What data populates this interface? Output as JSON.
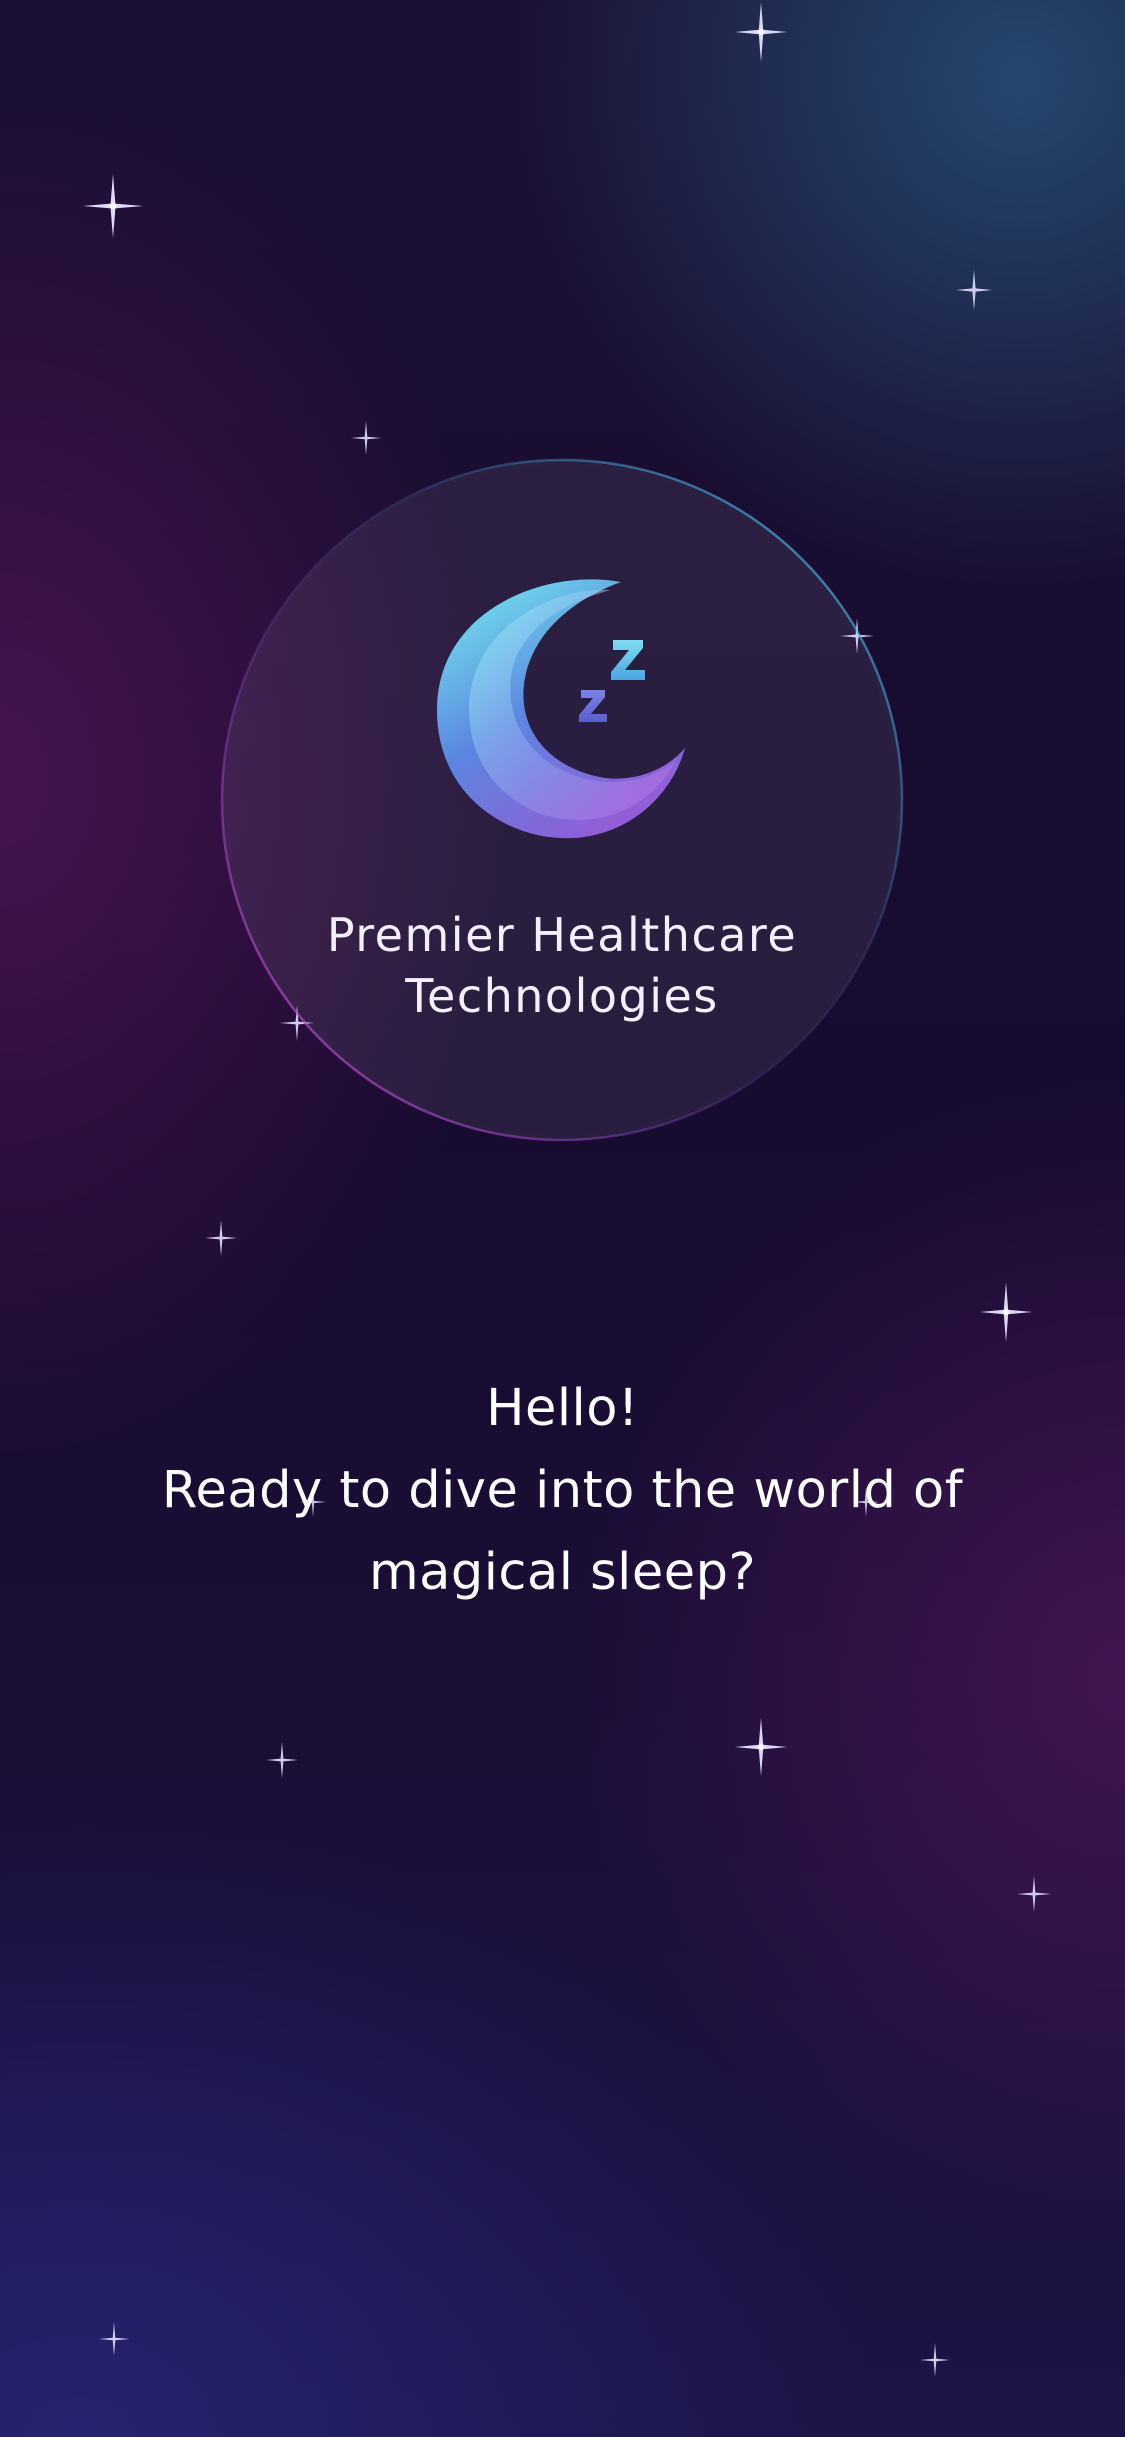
{
  "app": {
    "company_name_line1": "Premier Healthcare",
    "company_name_line2": "Technologies",
    "logo_icon": "sleeping-moon-icon"
  },
  "welcome": {
    "greeting": "Hello!",
    "message_line1": "Ready to dive into the world of",
    "message_line2": "magical sleep?"
  },
  "decorations": {
    "star_icon": "sparkle-star-icon",
    "star_color": "#d9d4ff"
  },
  "colors": {
    "background_dark": "#160c30",
    "moon_cyan": "#6fd6ea",
    "moon_purple": "#a05ad8",
    "text": "#ffffff"
  }
}
